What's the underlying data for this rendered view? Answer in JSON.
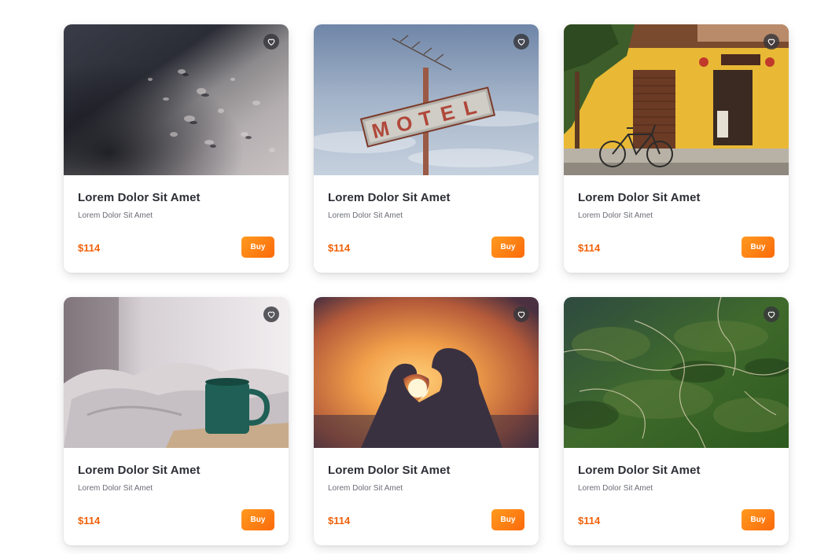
{
  "products": [
    {
      "image": "water-droplets-photo",
      "title": "Lorem Dolor Sit Amet",
      "subtitle": "Lorem Dolor Sit Amet",
      "price": "$114",
      "buy_label": "Buy"
    },
    {
      "image": "motel-sign-photo",
      "title": "Lorem Dolor Sit Amet",
      "subtitle": "Lorem Dolor Sit Amet",
      "price": "$114",
      "buy_label": "Buy"
    },
    {
      "image": "yellow-house-bicycle-photo",
      "title": "Lorem Dolor Sit Amet",
      "subtitle": "Lorem Dolor Sit Amet",
      "price": "$114",
      "buy_label": "Buy"
    },
    {
      "image": "coffee-mug-bed-photo",
      "title": "Lorem Dolor Sit Amet",
      "subtitle": "Lorem Dolor Sit Amet",
      "price": "$114",
      "buy_label": "Buy"
    },
    {
      "image": "heart-hands-sunset-photo",
      "title": "Lorem Dolor Sit Amet",
      "subtitle": "Lorem Dolor Sit Amet",
      "price": "$114",
      "buy_label": "Buy"
    },
    {
      "image": "aerial-green-hills-photo",
      "title": "Lorem Dolor Sit Amet",
      "subtitle": "Lorem Dolor Sit Amet",
      "price": "$114",
      "buy_label": "Buy"
    }
  ],
  "icons": {
    "favorite": "heart-outline-icon"
  },
  "colors": {
    "accent": "#fb6a0b",
    "accent_light": "#ff9a1f",
    "price": "#f0620a",
    "title": "#2d2f36",
    "subtitle": "#6a6d75"
  }
}
